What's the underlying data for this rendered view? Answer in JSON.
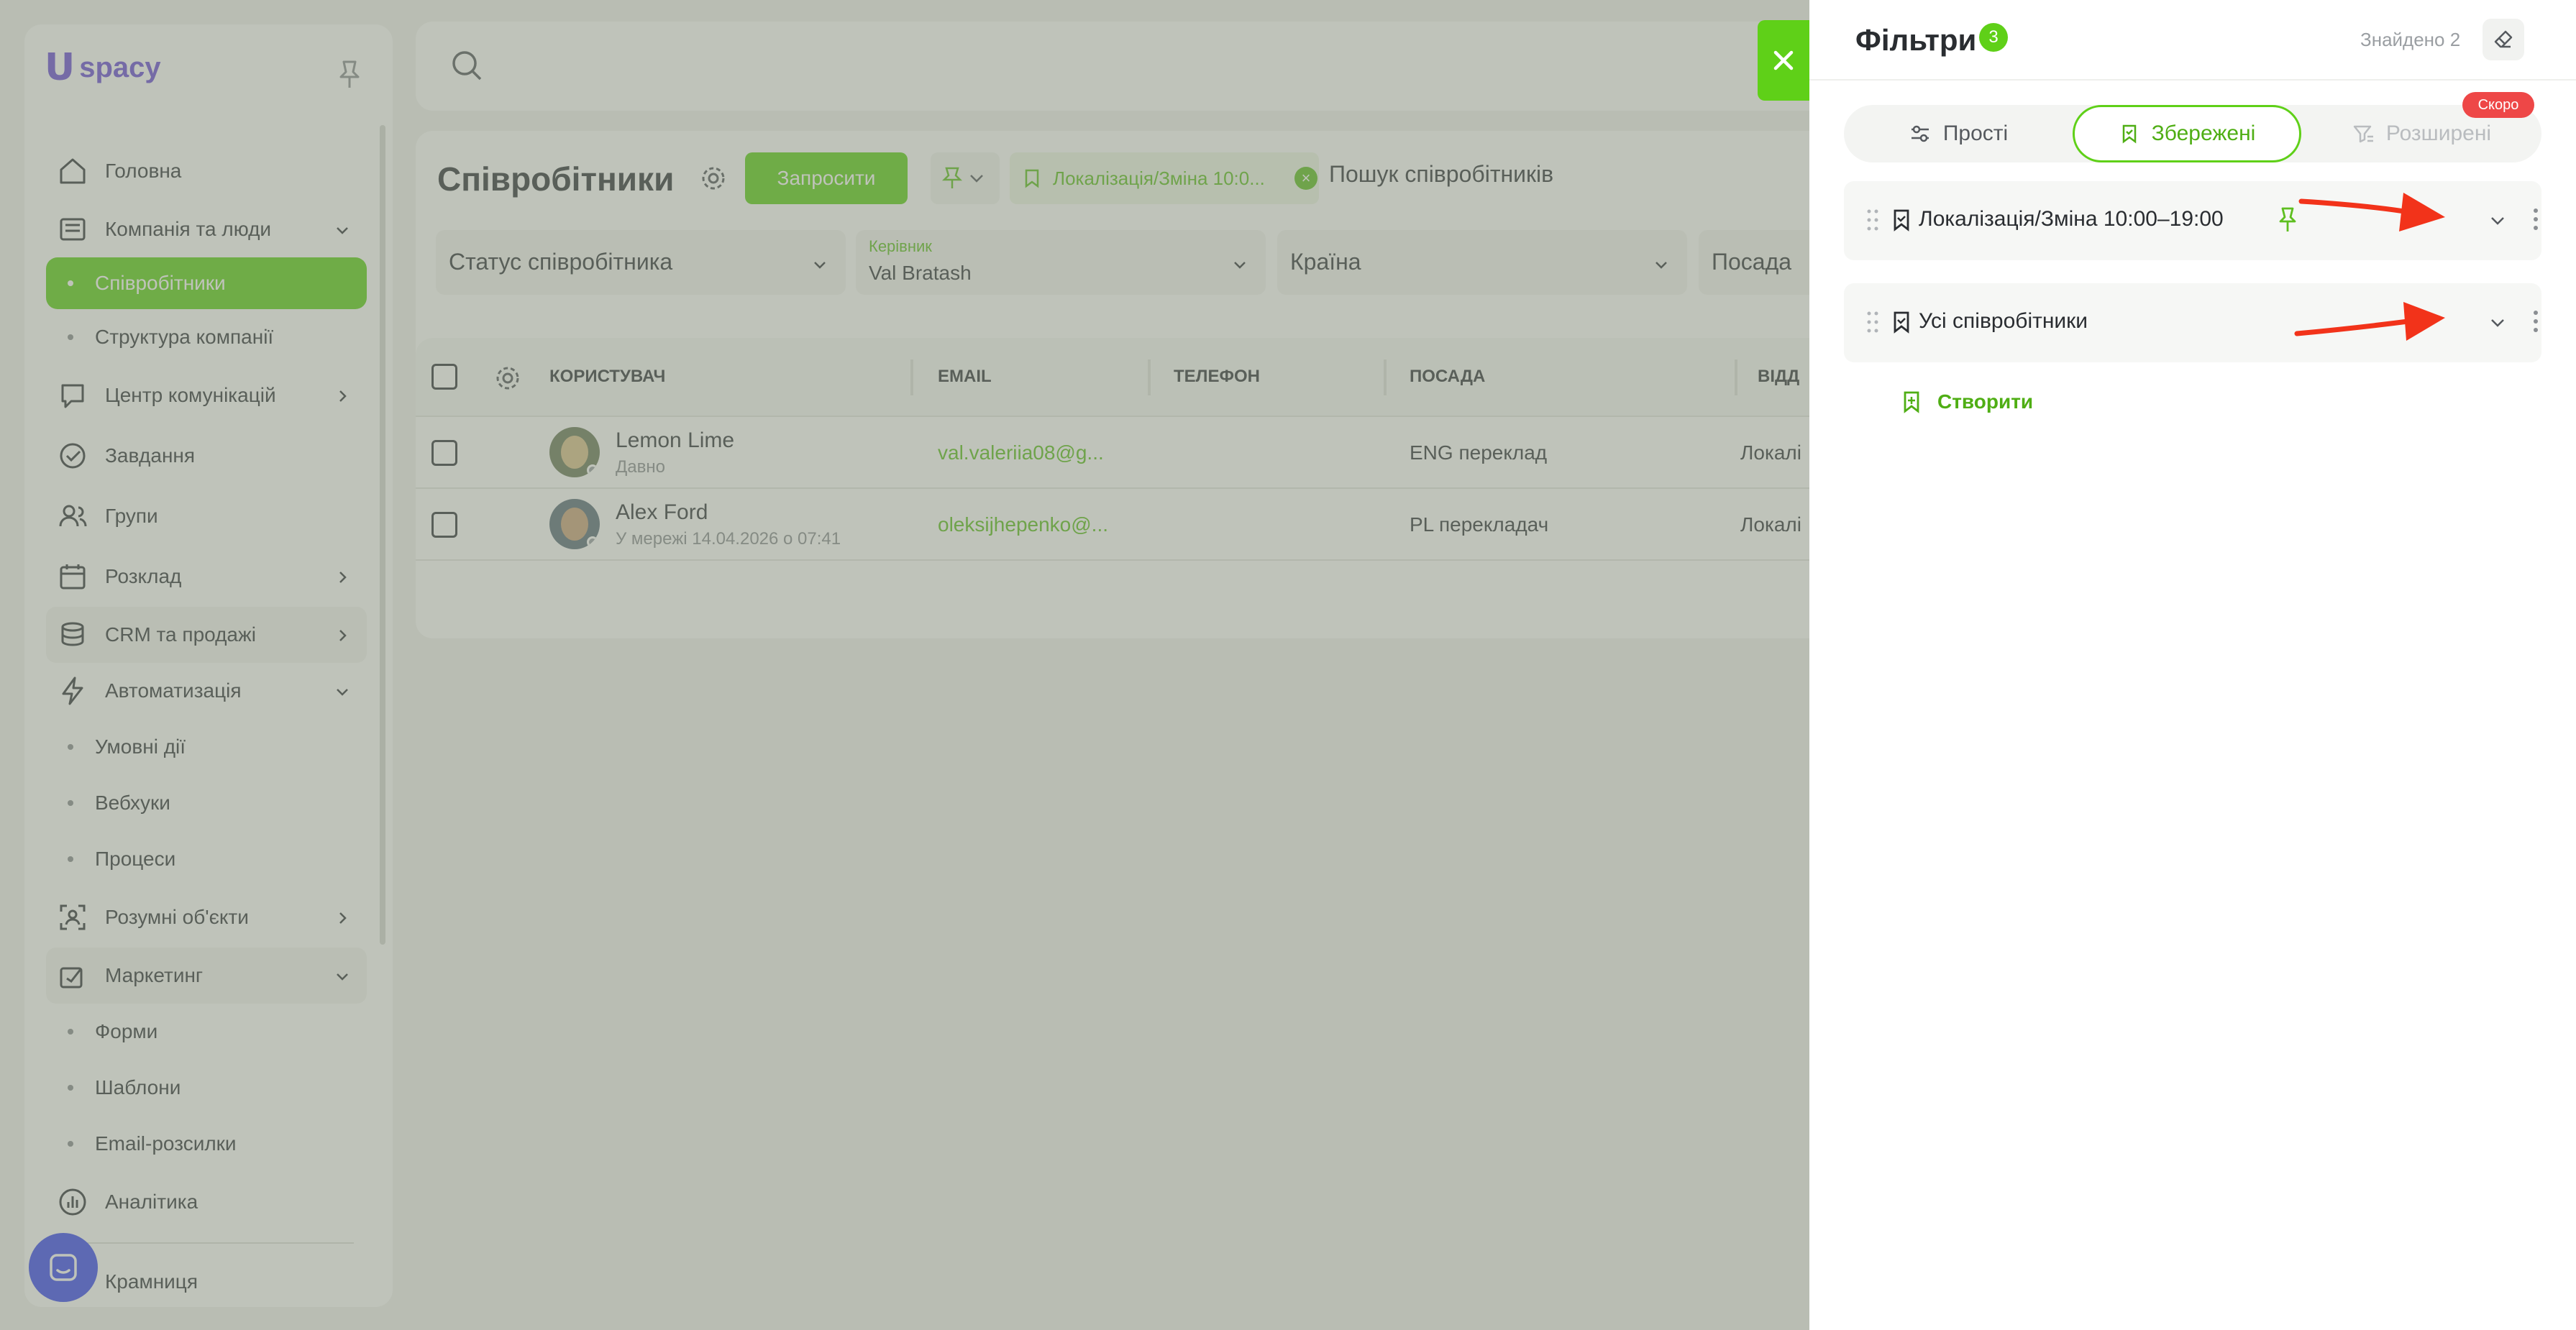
{
  "app": {
    "logo_mark": "U",
    "logo_text": "spacy"
  },
  "sidebar": {
    "items": [
      {
        "label": "Головна",
        "icon": "home-icon"
      },
      {
        "label": "Компанія та люди",
        "icon": "company-icon",
        "expanded": true
      },
      {
        "label": "Співробітники",
        "sub": true,
        "active": true
      },
      {
        "label": "Структура компанії",
        "sub": true
      },
      {
        "label": "Центр комунікацій",
        "icon": "communications-icon"
      },
      {
        "label": "Завдання",
        "icon": "tasks-icon"
      },
      {
        "label": "Групи",
        "icon": "groups-icon"
      },
      {
        "label": "Розклад",
        "icon": "calendar-icon"
      },
      {
        "label": "CRM та продажі",
        "icon": "crm-icon"
      },
      {
        "label": "Автоматизація",
        "icon": "automation-icon",
        "expanded": true
      },
      {
        "label": "Умовні дії",
        "sub": true
      },
      {
        "label": "Вебхуки",
        "sub": true
      },
      {
        "label": "Процеси",
        "sub": true
      },
      {
        "label": "Розумні об'єкти",
        "icon": "smart-objects-icon"
      },
      {
        "label": "Маркетинг",
        "icon": "marketing-icon",
        "expanded": true
      },
      {
        "label": "Форми",
        "sub": true
      },
      {
        "label": "Шаблони",
        "sub": true
      },
      {
        "label": "Email-розсилки",
        "sub": true
      },
      {
        "label": "Аналітика",
        "icon": "analytics-icon"
      },
      {
        "label": "Крамниця",
        "icon": "shop-icon"
      }
    ]
  },
  "page": {
    "title": "Співробітники",
    "invite_label": "Запросити",
    "chip_label": "Локалізація/Зміна 10:0...",
    "search_placeholder": "Пошук співробітників",
    "filters": {
      "status": "Статус співробітника",
      "manager_label": "Керівник",
      "manager_value": "Val Bratash",
      "country": "Країна",
      "position": "Посада"
    }
  },
  "table": {
    "columns": [
      "КОРИСТУВАЧ",
      "EMAIL",
      "ТЕЛЕФОН",
      "ПОСАДА",
      "ВІДД"
    ],
    "rows": [
      {
        "name": "Lemon Lime",
        "status": "Давно",
        "email": "val.valeriia08@g...",
        "phone": "",
        "position": "ENG переклад",
        "department": "Локалі"
      },
      {
        "name": "Alex Ford",
        "status": "У мережі 14.04.2026 о 07:41",
        "email": "oleksijhepenko@...",
        "phone": "",
        "position": "PL перекладач",
        "department": "Локалі"
      }
    ]
  },
  "filters_panel": {
    "title": "Фільтри",
    "count": "3",
    "found": "Знайдено 2",
    "tabs": [
      {
        "label": "Прості",
        "icon": "sliders-icon"
      },
      {
        "label": "Збережені",
        "icon": "bookmark-icon",
        "active": true
      },
      {
        "label": "Розширені",
        "icon": "advanced-filter-icon",
        "disabled": true
      }
    ],
    "soon_badge": "Скоро",
    "saved": [
      {
        "label": "Локалізація/Зміна 10:00–19:00",
        "pinned": true
      },
      {
        "label": "Усі співробітники",
        "pinned": false
      }
    ],
    "create_label": "Створити"
  },
  "colors": {
    "accent": "#5fd018",
    "accent_text": "#4fae14",
    "badge_red": "#ee4747",
    "annotation_arrow": "#f2331a",
    "logo": "#6a4fd6",
    "chat": "#3b4bf0"
  }
}
